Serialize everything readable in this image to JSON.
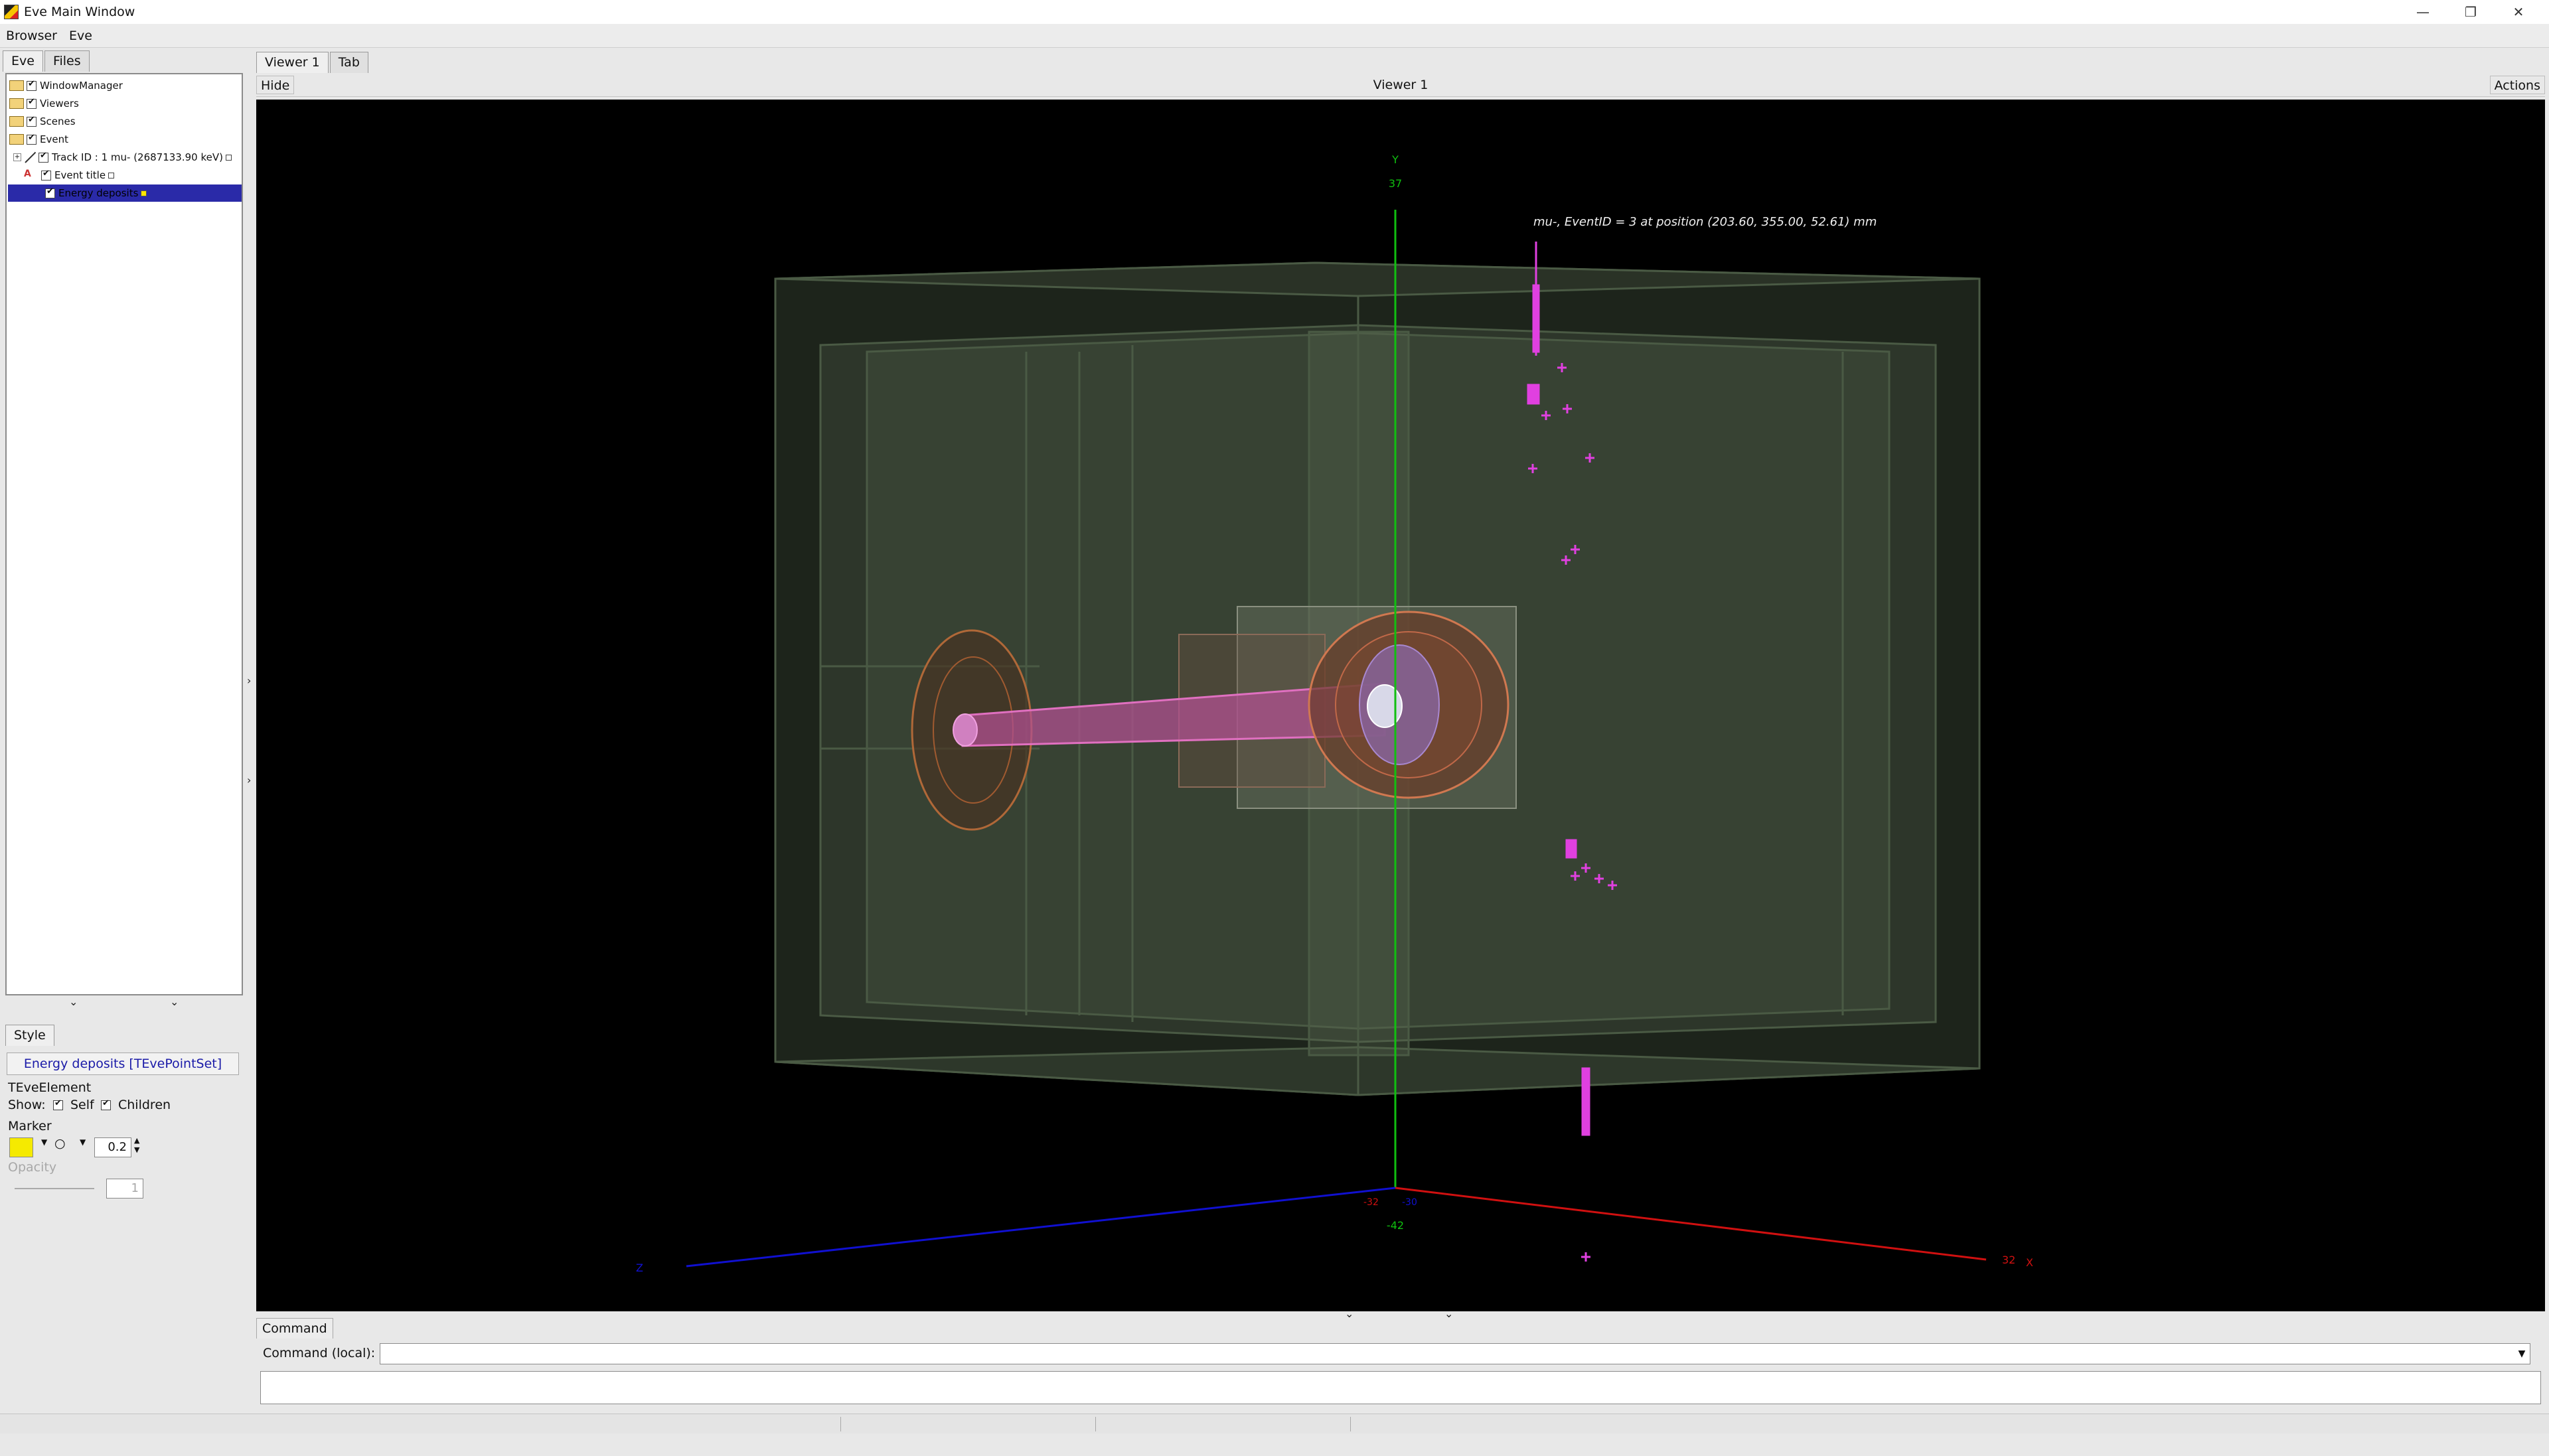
{
  "window": {
    "title": "Eve Main Window",
    "controls": [
      "minimize-icon",
      "restore-icon",
      "close-icon"
    ],
    "control_glyphs": [
      "—",
      "❐",
      "✕"
    ]
  },
  "menubar": {
    "items": [
      "Browser",
      "Eve"
    ]
  },
  "left_panel": {
    "tabs": [
      "Eve",
      "Files"
    ],
    "tree": {
      "items": [
        {
          "label": "WindowManager",
          "checked": true
        },
        {
          "label": "Viewers",
          "checked": true
        },
        {
          "label": "Scenes",
          "checked": true
        },
        {
          "label": "Event",
          "checked": true
        },
        {
          "label": "Track ID : 1 mu- (2687133.90 keV)",
          "checked": true
        },
        {
          "label": "Event title",
          "checked": true
        },
        {
          "label": "Energy deposits",
          "checked": true,
          "selected": true
        }
      ]
    },
    "editor": {
      "tab": "Style",
      "title": "Energy deposits [TEvePointSet]",
      "section_element": "TEveElement",
      "show_label": "Show:",
      "self_label": "Self",
      "children_label": "Children",
      "marker_label": "Marker",
      "marker_color": "#f5ea00",
      "marker_size": "0.2",
      "opacity_label": "Opacity",
      "opacity_value": "1"
    }
  },
  "viewer": {
    "tabs": [
      "Viewer 1",
      "Tab"
    ],
    "hide_label": "Hide",
    "title": "Viewer 1",
    "actions_label": "Actions",
    "annotation": "mu-, EventID = 3 at position (203.60, 355.00, 52.61) mm",
    "axes": {
      "y_label": "Y",
      "y_top_tick": "37",
      "y_bottom_tick": "-42",
      "x_label": "X",
      "x_tick": "32",
      "z_label": "Z",
      "origin_left": "-32",
      "origin_right": "-30"
    },
    "colors": {
      "background": "#000000",
      "hits": "#e040e0",
      "x_axis": "#d01010",
      "y_axis": "#10c010",
      "z_axis": "#1010d0",
      "detector": "#5a6a50"
    }
  },
  "command": {
    "tab": "Command",
    "label": "Command (local):",
    "value": ""
  }
}
